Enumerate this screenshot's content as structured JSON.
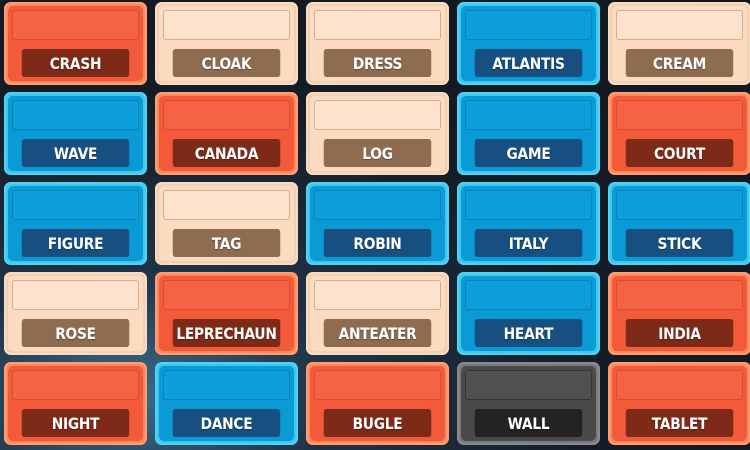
{
  "board": {
    "rows": [
      [
        {
          "word": "CRASH",
          "team": "red"
        },
        {
          "word": "CLOAK",
          "team": "neutral"
        },
        {
          "word": "DRESS",
          "team": "neutral"
        },
        {
          "word": "ATLANTIS",
          "team": "blue"
        },
        {
          "word": "CREAM",
          "team": "neutral"
        }
      ],
      [
        {
          "word": "WAVE",
          "team": "blue"
        },
        {
          "word": "CANADA",
          "team": "red"
        },
        {
          "word": "LOG",
          "team": "neutral"
        },
        {
          "word": "GAME",
          "team": "blue"
        },
        {
          "word": "COURT",
          "team": "red"
        }
      ],
      [
        {
          "word": "FIGURE",
          "team": "blue"
        },
        {
          "word": "TAG",
          "team": "neutral"
        },
        {
          "word": "ROBIN",
          "team": "blue"
        },
        {
          "word": "ITALY",
          "team": "blue"
        },
        {
          "word": "STICK",
          "team": "blue"
        }
      ],
      [
        {
          "word": "ROSE",
          "team": "neutral"
        },
        {
          "word": "LEPRECHAUN",
          "team": "red"
        },
        {
          "word": "ANTEATER",
          "team": "neutral"
        },
        {
          "word": "HEART",
          "team": "blue"
        },
        {
          "word": "INDIA",
          "team": "red"
        }
      ],
      [
        {
          "word": "NIGHT",
          "team": "red"
        },
        {
          "word": "DANCE",
          "team": "blue"
        },
        {
          "word": "BUGLE",
          "team": "red"
        },
        {
          "word": "WALL",
          "team": "assassin"
        },
        {
          "word": "TABLET",
          "team": "red"
        }
      ]
    ]
  },
  "colors": {
    "red": "#f25a3a",
    "blue": "#0a9ad6",
    "neutral": "#fcdcc0",
    "assassin": "#4a4a4a"
  }
}
